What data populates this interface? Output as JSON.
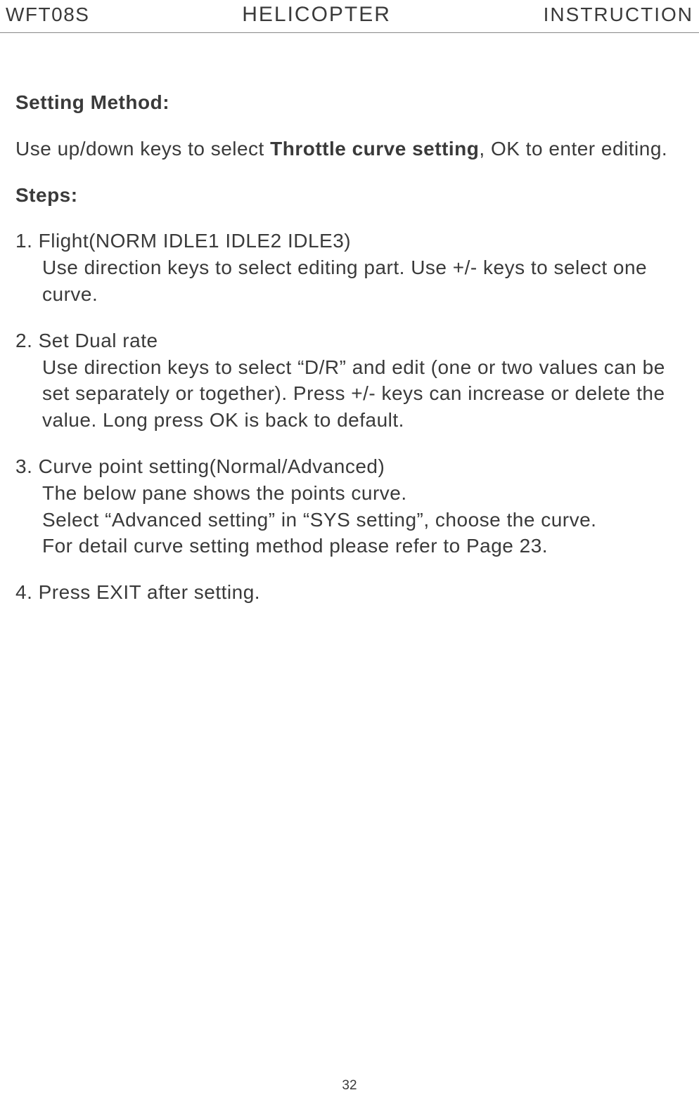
{
  "header": {
    "left": "WFT08S",
    "center": "HELICOPTER",
    "right": "INSTRUCTION"
  },
  "content": {
    "settingMethodTitle": "Setting Method:",
    "introPrefix": "Use up/down keys to select ",
    "introBold": "Throttle curve setting",
    "introSuffix": ", OK to enter editing.",
    "stepsTitle": "Steps:",
    "step1": {
      "header": "1. Flight(NORM IDLE1 IDLE2 IDLE3)",
      "body": "Use direction keys to select editing part. Use +/- keys to select one curve."
    },
    "step2": {
      "header": "2. Set Dual rate",
      "body": "Use direction keys to select “D/R” and edit (one or two values can be set separately or together). Press +/- keys can increase or delete the value. Long press OK is back to default."
    },
    "step3": {
      "header": "3. Curve point setting(Normal/Advanced)",
      "line1": "The below pane shows the points curve.",
      "line2": "Select “Advanced setting” in “SYS setting”, choose the curve.",
      "line3": "For detail curve setting method please refer to Page 23."
    },
    "step4": {
      "header": "4. Press EXIT after setting."
    }
  },
  "pageNumber": "32"
}
